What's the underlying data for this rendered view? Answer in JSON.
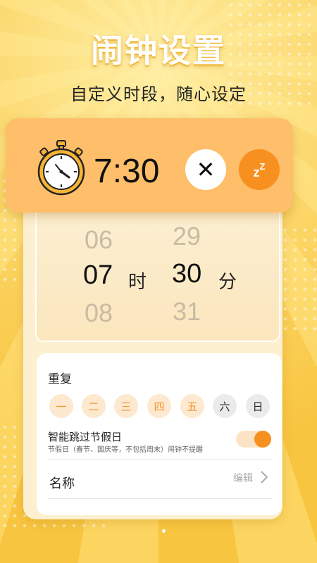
{
  "header": {
    "title": "闹钟设置",
    "subtitle": "自定义时段，随心设定"
  },
  "alarm": {
    "time": "7:30",
    "close_symbol": "✕",
    "snooze_symbol": "zZ",
    "icon": "stopwatch-icon"
  },
  "picker": {
    "hours": [
      "06",
      "07",
      "08"
    ],
    "hour_unit": "时",
    "minutes": [
      "29",
      "30",
      "31"
    ],
    "minute_unit": "分"
  },
  "repeat": {
    "label": "重复",
    "days": [
      {
        "label": "一",
        "active": true
      },
      {
        "label": "二",
        "active": true
      },
      {
        "label": "三",
        "active": true
      },
      {
        "label": "四",
        "active": true
      },
      {
        "label": "五",
        "active": true
      },
      {
        "label": "六",
        "active": false
      },
      {
        "label": "日",
        "active": false
      }
    ]
  },
  "holiday": {
    "label": "智能跳过节假日",
    "description": "节假日（春节、国庆等，不包括周末）闹钟不提醒",
    "enabled": true
  },
  "name_row": {
    "label": "名称",
    "action": "编辑"
  },
  "colors": {
    "accent": "#f7901e",
    "banner": "#ffbe6a",
    "background": "#fcd25a"
  }
}
